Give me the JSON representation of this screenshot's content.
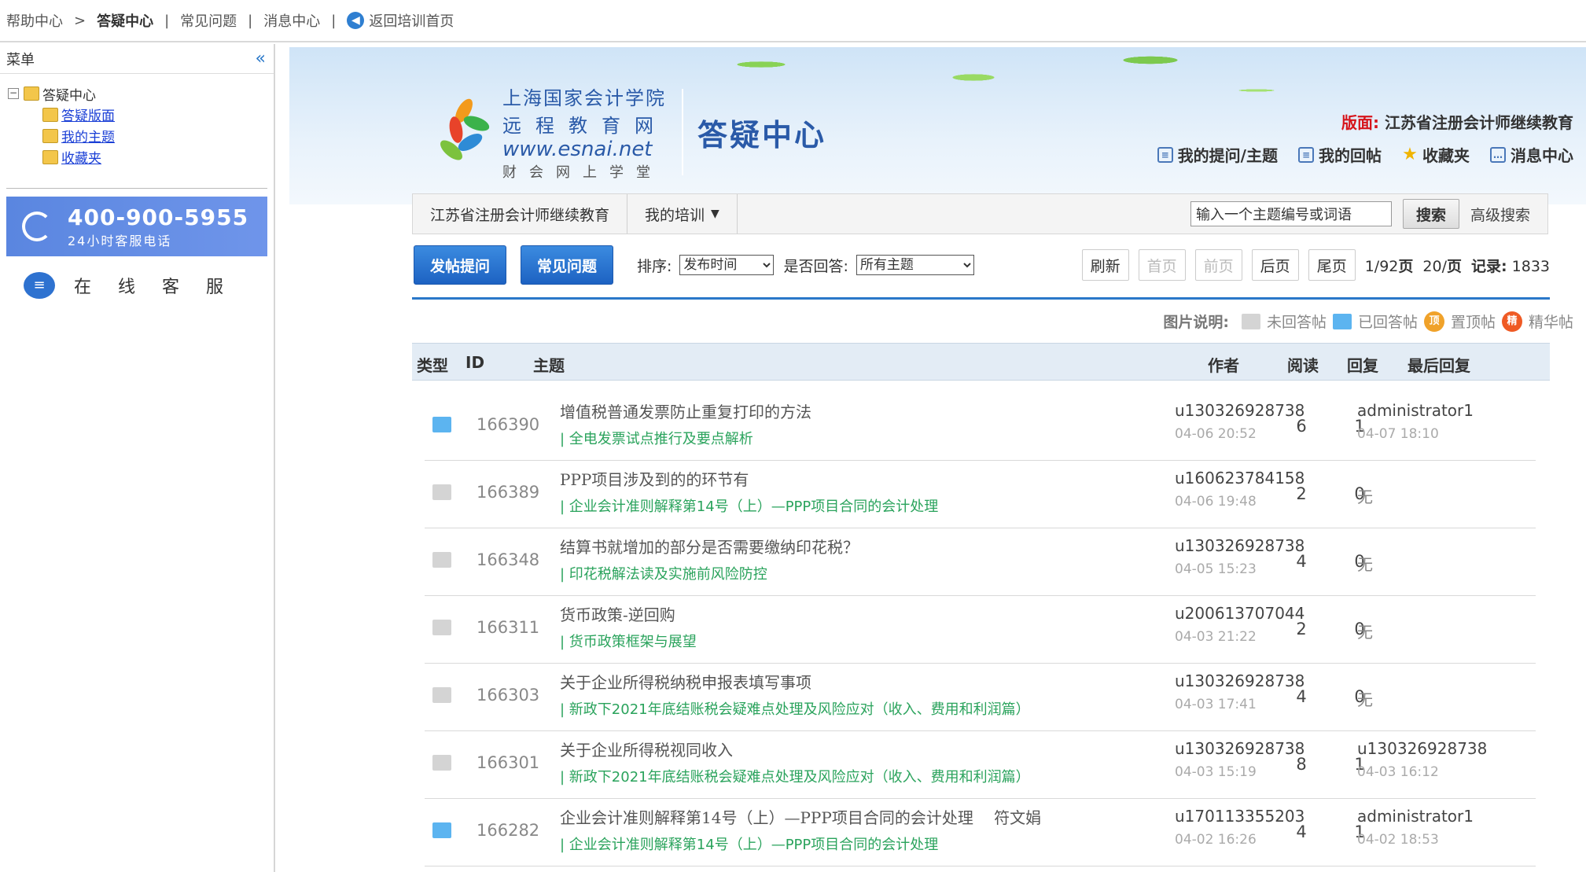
{
  "topbar": {
    "help_center": "帮助中心",
    "arrow": ">",
    "qa_center": "答疑中心",
    "divider": "|",
    "faq": "常见问题",
    "messages": "消息中心",
    "back_home": "返回培训首页"
  },
  "sidebar": {
    "title": "菜单",
    "collapse_glyph": "«",
    "tree_root": "答疑中心",
    "items": [
      "答疑版面",
      "我的主题",
      "收藏夹"
    ],
    "hotline_number": "400-900-5955",
    "hotline_sub": "24小时客服电话",
    "online_service": "在线客服"
  },
  "banner": {
    "logo_line1": "上海国家会计学院",
    "logo_line2": "远程教育网",
    "logo_line3": "www.esnai.net",
    "logo_line4": "财会网上学堂",
    "site_title": "答疑中心",
    "board_label": "版面:",
    "board_name": "江苏省注册会计师继续教育",
    "links": {
      "my_questions": "我的提问/主题",
      "my_replies": "我的回帖",
      "favorites": "收藏夹",
      "messages": "消息中心"
    }
  },
  "navbar": {
    "crumb1": "江苏省注册会计师继续教育",
    "crumb2": "我的培训",
    "search_value": "输入一个主题编号或词语",
    "search_button": "搜索",
    "advanced": "高级搜索"
  },
  "toolbar": {
    "post_button": "发帖提问",
    "faq_button": "常见问题",
    "sort_label": "排序:",
    "sort_value": "发布时间",
    "answered_label": "是否回答:",
    "answered_value": "所有主题",
    "refresh": "刷新",
    "first": "首页",
    "prev": "前页",
    "next": "后页",
    "last": "尾页",
    "page_current": "1/92",
    "page_unit": "页",
    "page_size": "20/",
    "page_size_unit": "页",
    "records_label": "记录:",
    "records": "1833"
  },
  "legend": {
    "title": "图片说明:",
    "unanswered": "未回答帖",
    "answered": "已回答帖",
    "pinned": "置顶帖",
    "pinned_badge": "顶",
    "featured": "精华帖",
    "featured_badge": "精"
  },
  "table": {
    "headers": {
      "type": "类型",
      "id": "ID",
      "subject": "主题",
      "author": "作者",
      "reads": "阅读",
      "replies": "回复",
      "last_reply": "最后回复"
    },
    "rows": [
      {
        "status": "answered",
        "id": "166390",
        "subject": "增值税普通发票防止重复打印的方法",
        "course": "| 全电发票试点推行及要点解析",
        "author": "u130326928738",
        "time": "04-06 20:52",
        "reads": "6",
        "replies": "1",
        "last_by": "administrator1",
        "last_time": "04-07 18:10"
      },
      {
        "status": "unanswered",
        "id": "166389",
        "subject": "PPP项目涉及到的的环节有",
        "course": "| 企业会计准则解释第14号（上）—PPP项目合同的会计处理",
        "author": "u160623784158",
        "time": "04-06 19:48",
        "reads": "2",
        "replies": "0",
        "last_by": "无",
        "last_time": ""
      },
      {
        "status": "unanswered",
        "id": "166348",
        "subject": "结算书就增加的部分是否需要缴纳印花税？",
        "course": "| 印花税解法读及实施前风险防控",
        "author": "u130326928738",
        "time": "04-05 15:23",
        "reads": "4",
        "replies": "0",
        "last_by": "无",
        "last_time": ""
      },
      {
        "status": "unanswered",
        "id": "166311",
        "subject": "货币政策-逆回购",
        "course": "| 货币政策框架与展望",
        "author": "u200613707044",
        "time": "04-03 21:22",
        "reads": "2",
        "replies": "0",
        "last_by": "无",
        "last_time": ""
      },
      {
        "status": "unanswered",
        "id": "166303",
        "subject": "关于企业所得税纳税申报表填写事项",
        "course": "| 新政下2021年底结账税会疑难点处理及风险应对（收入、费用和利润篇）",
        "author": "u130326928738",
        "time": "04-03 17:41",
        "reads": "4",
        "replies": "0",
        "last_by": "无",
        "last_time": ""
      },
      {
        "status": "unanswered",
        "id": "166301",
        "subject": "关于企业所得税视同收入",
        "course": "| 新政下2021年底结账税会疑难点处理及风险应对（收入、费用和利润篇）",
        "author": "u130326928738",
        "time": "04-03 15:19",
        "reads": "8",
        "replies": "1",
        "last_by": "u130326928738",
        "last_time": "04-03 16:12"
      },
      {
        "status": "answered",
        "id": "166282",
        "subject": "企业会计准则解释第14号（上）—PPP项目合同的会计处理　 符文娟",
        "course": "| 企业会计准则解释第14号（上）—PPP项目合同的会计处理",
        "author": "u170113355203",
        "time": "04-02 16:26",
        "reads": "4",
        "replies": "1",
        "last_by": "administrator1",
        "last_time": "04-02 18:53"
      }
    ]
  },
  "colors": {
    "accent_blue": "#2a78c9",
    "course_green": "#2aa35c",
    "board_red": "#d6141b",
    "answered_folder": "#5cb4f0",
    "unanswered_folder": "#d4d4d4"
  }
}
